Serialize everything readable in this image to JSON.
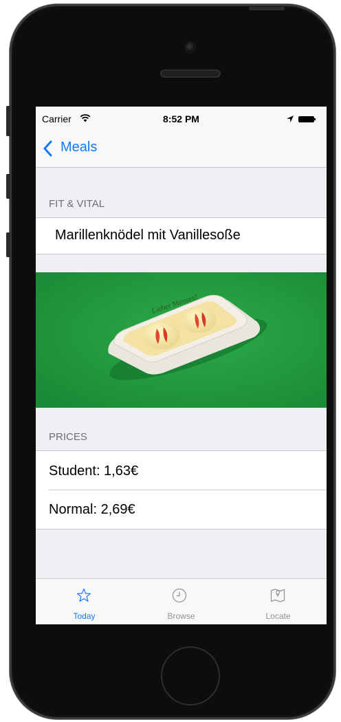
{
  "statusbar": {
    "carrier": "Carrier",
    "time": "8:52 PM"
  },
  "navbar": {
    "back_label": "Meals"
  },
  "meal": {
    "category": "FIT & VITAL",
    "name": "Marillenknödel mit Vanillesoße",
    "image_caption": "Lieber Mensen!"
  },
  "prices": {
    "header": "PRICES",
    "student": "Student: 1,63€",
    "normal": "Normal: 2,69€"
  },
  "tabbar": {
    "tabs": [
      {
        "label": "Today",
        "icon": "star-icon",
        "selected": true
      },
      {
        "label": "Browse",
        "icon": "clock-icon",
        "selected": false
      },
      {
        "label": "Locate",
        "icon": "map-icon",
        "selected": false
      }
    ]
  },
  "colors": {
    "accent": "#127afb",
    "inactive": "#929292",
    "group_background": "#efeff4",
    "image_green": "#229a3f"
  }
}
